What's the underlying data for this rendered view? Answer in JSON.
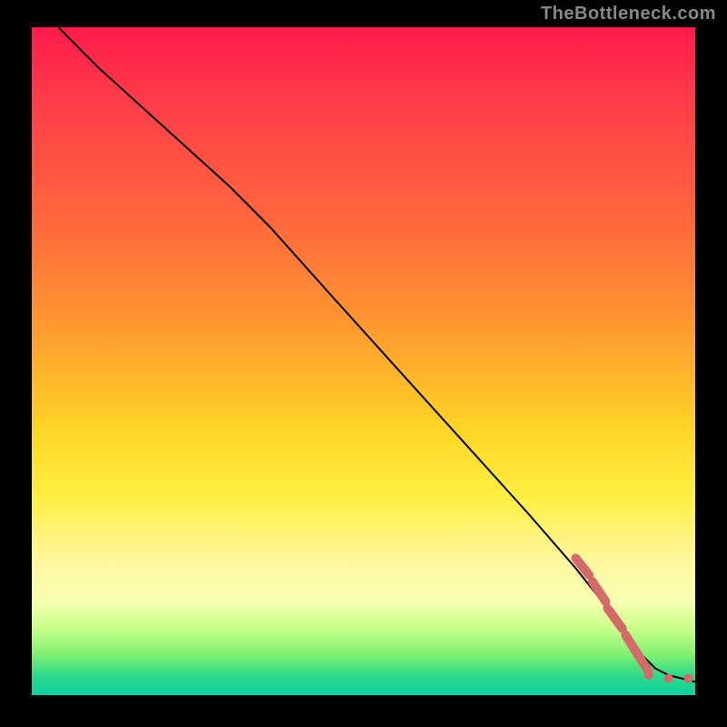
{
  "watermark": "TheBottleneck.com",
  "chart_data": {
    "type": "line",
    "title": "",
    "xlabel": "",
    "ylabel": "",
    "xlim": [
      0,
      100
    ],
    "ylim": [
      0,
      100
    ],
    "grid": false,
    "legend": false,
    "series": [
      {
        "name": "curve",
        "color": "#000000",
        "x": [
          4,
          10,
          20,
          30,
          36,
          45,
          55,
          65,
          75,
          82,
          86,
          88,
          90,
          92,
          94,
          96,
          98,
          100
        ],
        "y": [
          100,
          94,
          85,
          76,
          70,
          60,
          49,
          38,
          27,
          19,
          14,
          12,
          9,
          6,
          4,
          3,
          2.5,
          2
        ]
      }
    ],
    "markers": [
      {
        "shape": "rounded-bar",
        "x1": 82.0,
        "y1": 20.5,
        "x2": 84.0,
        "y2": 18.0,
        "color": "#d56a6a",
        "w": 10
      },
      {
        "shape": "rounded-bar",
        "x1": 84.5,
        "y1": 17.0,
        "x2": 86.5,
        "y2": 14.0,
        "color": "#d56a6a",
        "w": 10
      },
      {
        "shape": "rounded-bar",
        "x1": 86.8,
        "y1": 13.0,
        "x2": 89.0,
        "y2": 10.0,
        "color": "#d56a6a",
        "w": 10
      },
      {
        "shape": "rounded-bar",
        "x1": 89.5,
        "y1": 9.0,
        "x2": 93.0,
        "y2": 3.5,
        "color": "#d56a6a",
        "w": 10
      },
      {
        "shape": "circle",
        "cx": 93.0,
        "cy": 3.0,
        "r": 5,
        "color": "#d56a6a"
      },
      {
        "shape": "circle",
        "cx": 96.0,
        "cy": 2.5,
        "r": 5,
        "color": "#d56a6a"
      },
      {
        "shape": "circle",
        "cx": 99.0,
        "cy": 2.5,
        "r": 5,
        "color": "#d56a6a"
      }
    ]
  }
}
